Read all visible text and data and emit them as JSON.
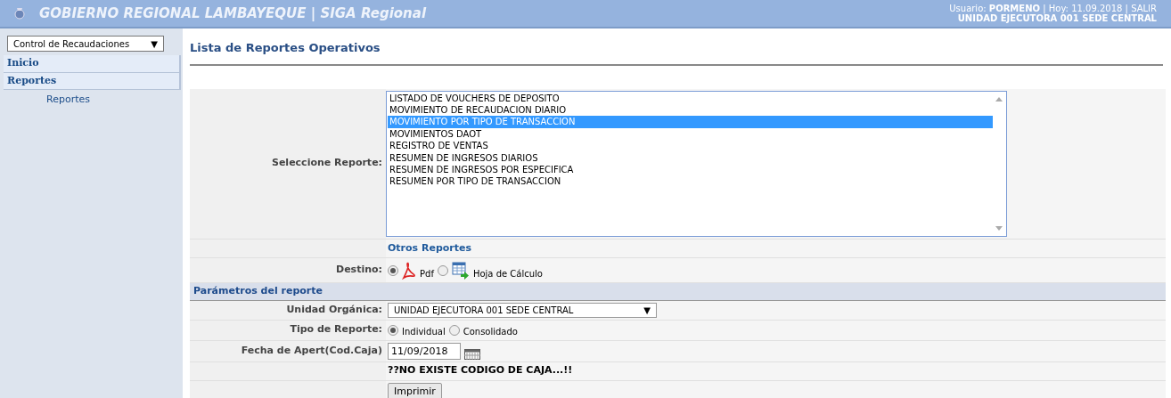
{
  "header": {
    "title": "GOBIERNO REGIONAL LAMBAYEQUE | SIGA Regional",
    "user_label": "Usuario:",
    "user": "PORMENO",
    "separator_1": "|",
    "date_label": "Hoy: 11.09.2018",
    "separator_2": "|",
    "logout": "SALIR",
    "unit": "UNIDAD EJECUTORA 001 SEDE CENTRAL"
  },
  "sidebar": {
    "module": "Control de Recaudaciones",
    "caret": "▼",
    "items": [
      {
        "label": "Inicio",
        "kind": "section"
      },
      {
        "label": "Reportes",
        "kind": "section"
      },
      {
        "label": "Reportes",
        "kind": "link"
      }
    ]
  },
  "page_title": "Lista de Reportes Operativos",
  "report_select": {
    "label": "Seleccione Reporte:",
    "options": [
      {
        "label": "LISTADO DE VOUCHERS DE DEPOSITO",
        "selected": false
      },
      {
        "label": "MOVIMIENTO DE RECAUDACION DIARIO",
        "selected": false
      },
      {
        "label": "MOVIMIENTO POR TIPO DE TRANSACCION",
        "selected": true
      },
      {
        "label": "MOVIMIENTOS DAOT",
        "selected": false
      },
      {
        "label": "REGISTRO DE VENTAS",
        "selected": false
      },
      {
        "label": "RESUMEN DE INGRESOS DIARIOS",
        "selected": false
      },
      {
        "label": "RESUMEN DE INGRESOS POR ESPECIFICA",
        "selected": false
      },
      {
        "label": "RESUMEN POR TIPO DE TRANSACCION",
        "selected": false
      }
    ]
  },
  "other_reports": "Otros Reportes",
  "destination": {
    "label": "Destino:",
    "options": [
      {
        "label": "Pdf",
        "kind": "pdf",
        "selected": true
      },
      {
        "label": "Hoja de Cálculo",
        "kind": "sheet",
        "selected": false
      }
    ]
  },
  "parameters": {
    "title": "Parámetros del reporte",
    "unit": {
      "label": "Unidad Orgánica:",
      "value": "UNIDAD EJECUTORA 001 SEDE CENTRAL",
      "caret": "▼"
    },
    "report_type": {
      "label": "Tipo de Reporte:",
      "options": [
        {
          "label": "Individual",
          "selected": true
        },
        {
          "label": "Consolidado",
          "selected": false
        }
      ]
    },
    "date": {
      "label": "Fecha de Apert(Cod.Caja)",
      "value": "11/09/2018"
    }
  },
  "message": "??NO EXISTE CODIGO DE CAJA...!!",
  "print_button": "Imprimir"
}
